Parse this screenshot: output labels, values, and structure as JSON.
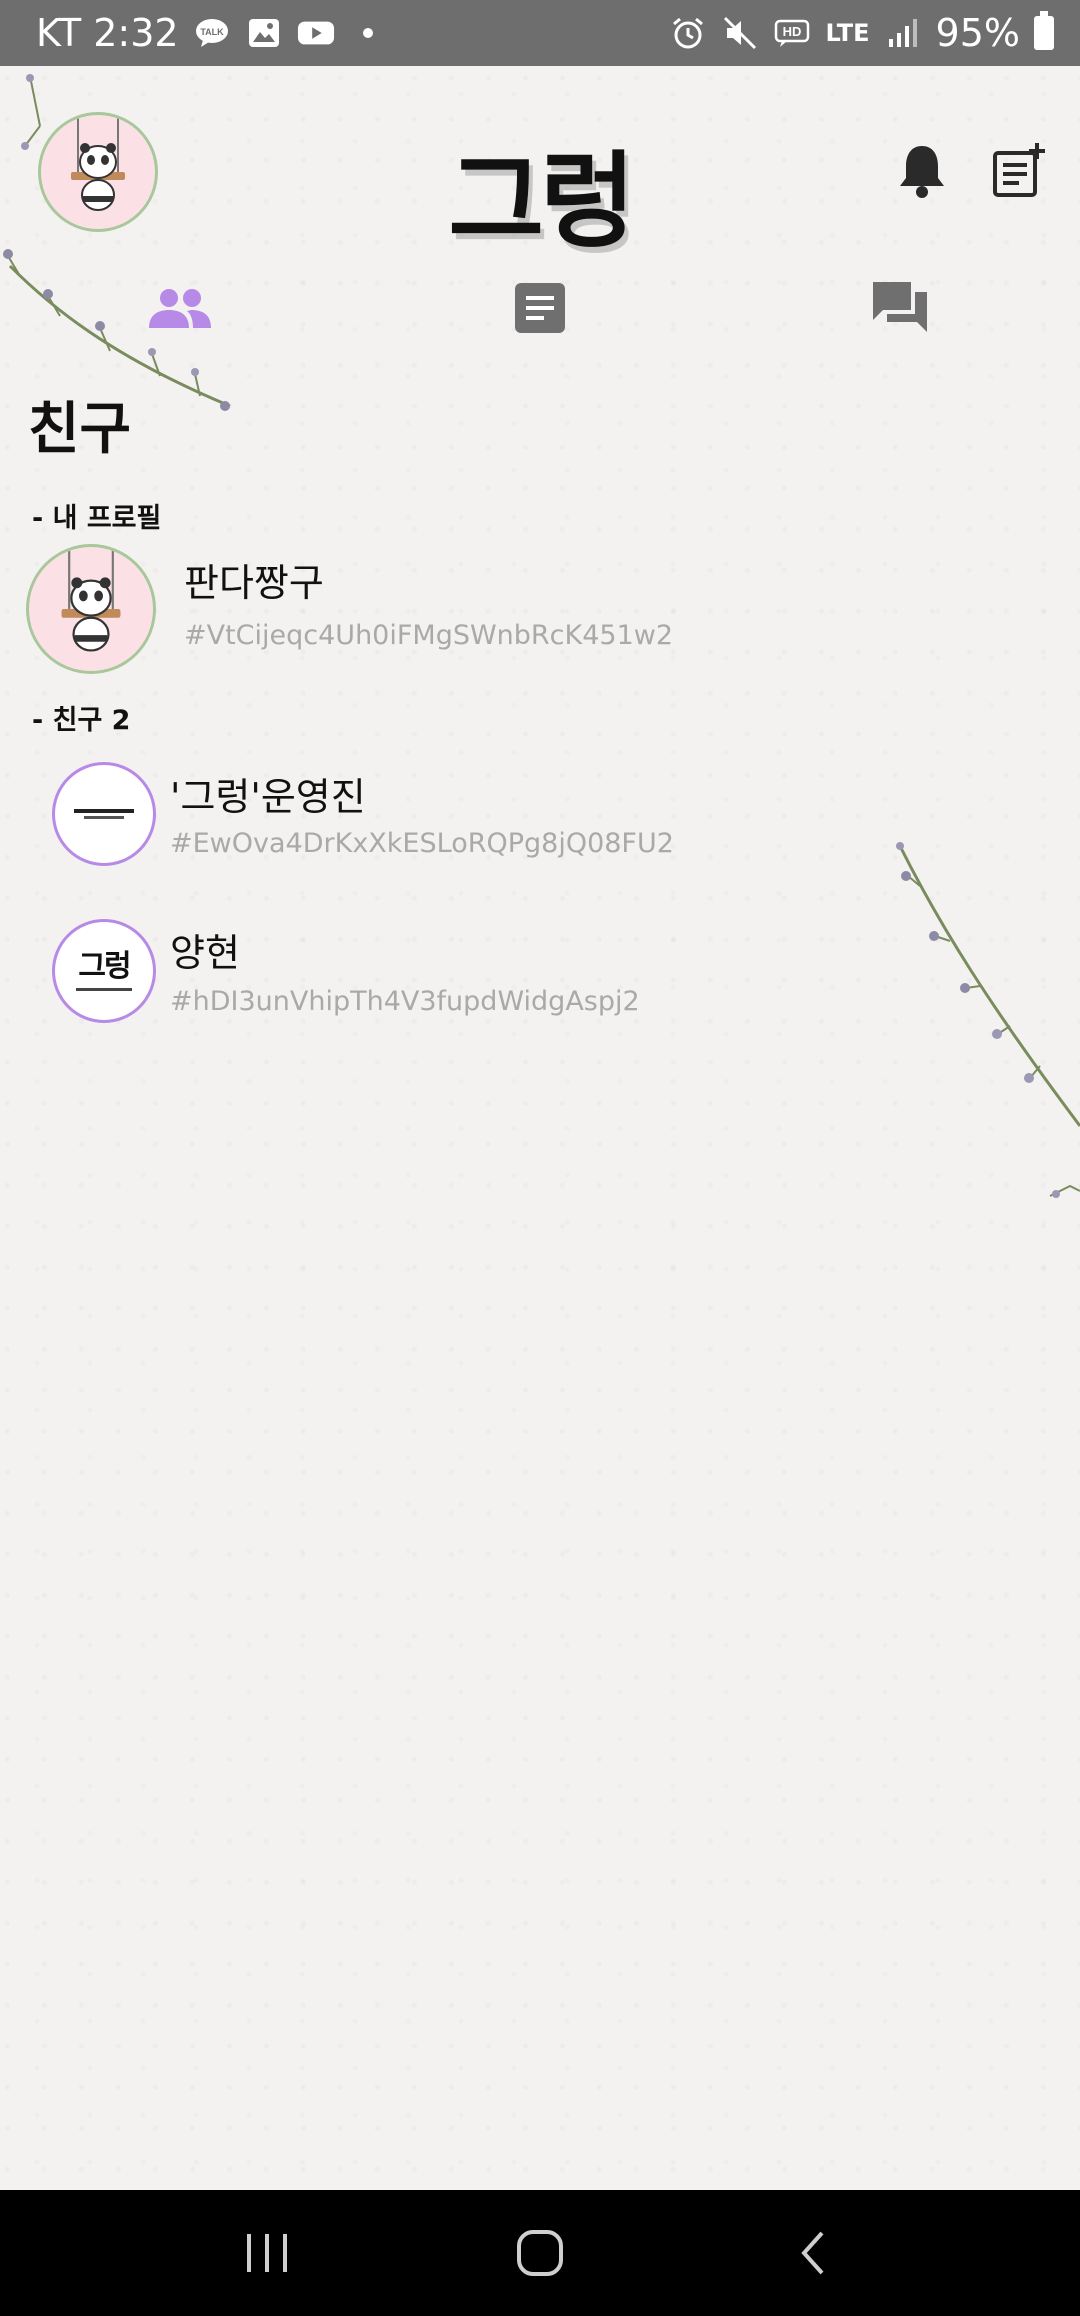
{
  "status_bar": {
    "carrier_time": "KT 2:32",
    "network": "LTE",
    "battery": "95%"
  },
  "header": {
    "app_title": "그렁"
  },
  "tabs": {
    "friends_icon": "people-icon",
    "posts_icon": "document-icon",
    "chat_icon": "chat-bubbles-icon",
    "active_color": "#b68ae6",
    "inactive_color": "#6f6f6f"
  },
  "friends_page": {
    "title": "친구",
    "my_profile_label": "- 내 프로필",
    "my_profile": {
      "name": "판다짱구",
      "uid": "#VtCijeqc4Uh0iFMgSWnbRcK451w2"
    },
    "friends_label": "- 친구 2",
    "friends": [
      {
        "name": "'그렁'운영진",
        "uid": "#EwOva4DrKxXkESLoRQPg8jQ08FU2"
      },
      {
        "name": "양현",
        "uid": "#hDI3unVhipTh4V3fupdWidgAspj2"
      }
    ]
  },
  "friend_avatar_text": {
    "logo": "그렁"
  }
}
